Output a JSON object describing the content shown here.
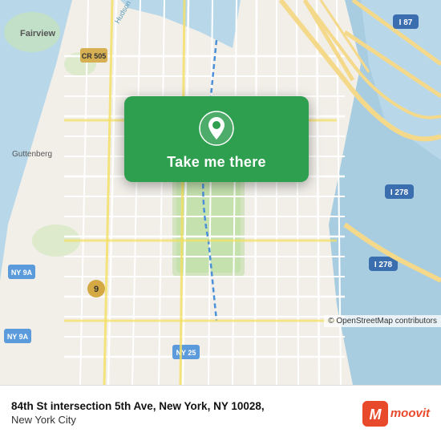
{
  "map": {
    "alt": "Map of Manhattan, New York showing 84th St and 5th Ave"
  },
  "card": {
    "button_label": "Take me there",
    "pin_color": "#ffffff"
  },
  "bottom_bar": {
    "location_title": "84th St intersection 5th Ave, New York, NY 10028,",
    "location_subtitle": "New York City",
    "osm_attribution": "© OpenStreetMap contributors",
    "moovit_label": "moovit"
  }
}
